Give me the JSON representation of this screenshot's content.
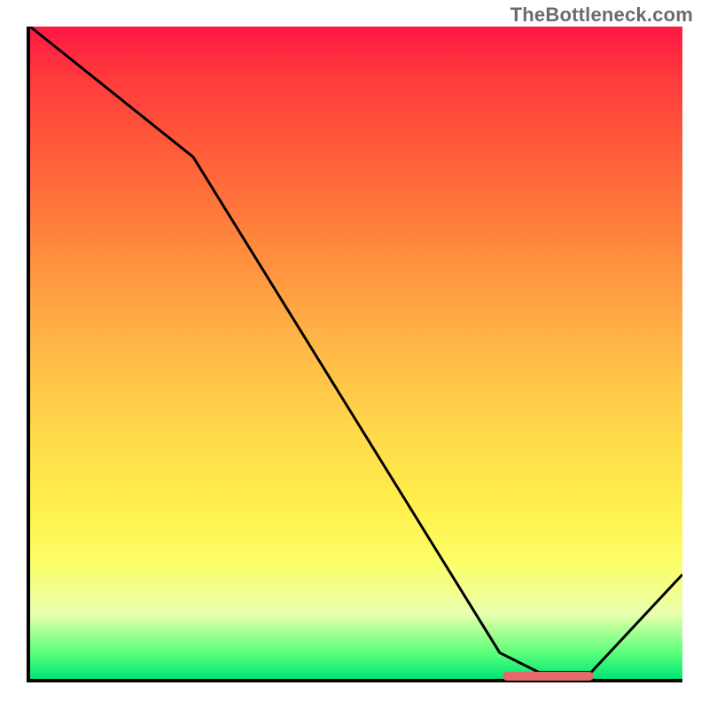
{
  "watermark": "TheBottleneck.com",
  "chart_data": {
    "type": "line",
    "title": "",
    "xlabel": "",
    "ylabel": "",
    "xlim": [
      0,
      100
    ],
    "ylim": [
      0,
      100
    ],
    "series": [
      {
        "name": "curve",
        "points": [
          {
            "x": 0,
            "y": 100
          },
          {
            "x": 25,
            "y": 80
          },
          {
            "x": 72,
            "y": 4
          },
          {
            "x": 78,
            "y": 1
          },
          {
            "x": 86,
            "y": 1
          },
          {
            "x": 100,
            "y": 16
          }
        ]
      }
    ],
    "marker": {
      "x_start": 72,
      "x_end": 86,
      "y": 1
    },
    "gradient_stops": [
      {
        "pos": 0,
        "color": "#ff1744"
      },
      {
        "pos": 100,
        "color": "#00e676"
      }
    ]
  }
}
